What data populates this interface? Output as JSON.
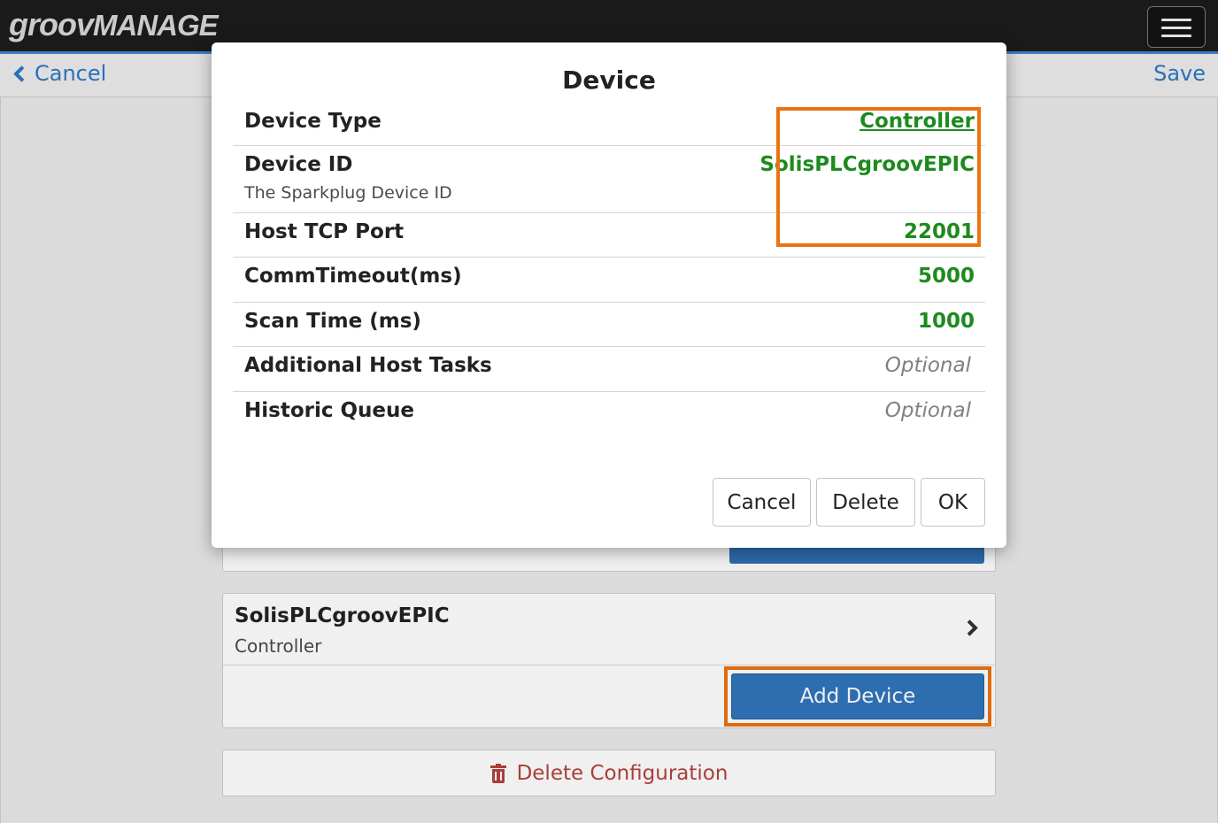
{
  "app": {
    "brand_part1": "groov",
    "brand_part2": "MANAGE",
    "menu_icon": "hamburger-menu-icon"
  },
  "nav": {
    "cancel_label": "Cancel",
    "save_label": "Save"
  },
  "background": {
    "device_card": {
      "name": "SolisPLCgroovEPIC",
      "type": "Controller"
    },
    "add_device_label": "Add Device",
    "delete_config_label": "Delete Configuration"
  },
  "modal": {
    "title": "Device",
    "rows": [
      {
        "label": "Device Type",
        "value": "Controller"
      },
      {
        "label": "Device ID",
        "sublabel": "The Sparkplug Device ID",
        "value": "SolisPLCgroovEPIC"
      },
      {
        "label": "Host TCP Port",
        "value": "22001"
      },
      {
        "label": "CommTimeout(ms)",
        "value": "5000"
      },
      {
        "label": "Scan Time (ms)",
        "value": "1000"
      },
      {
        "label": "Additional Host Tasks",
        "value": "Optional"
      },
      {
        "label": "Historic Queue",
        "value": "Optional"
      }
    ],
    "buttons": {
      "cancel": "Cancel",
      "delete": "Delete",
      "ok": "OK"
    }
  },
  "colors": {
    "accent_blue": "#2e78c3",
    "value_green": "#1e8a1e",
    "highlight_orange": "#ec7211",
    "danger_red": "#b4433d"
  }
}
